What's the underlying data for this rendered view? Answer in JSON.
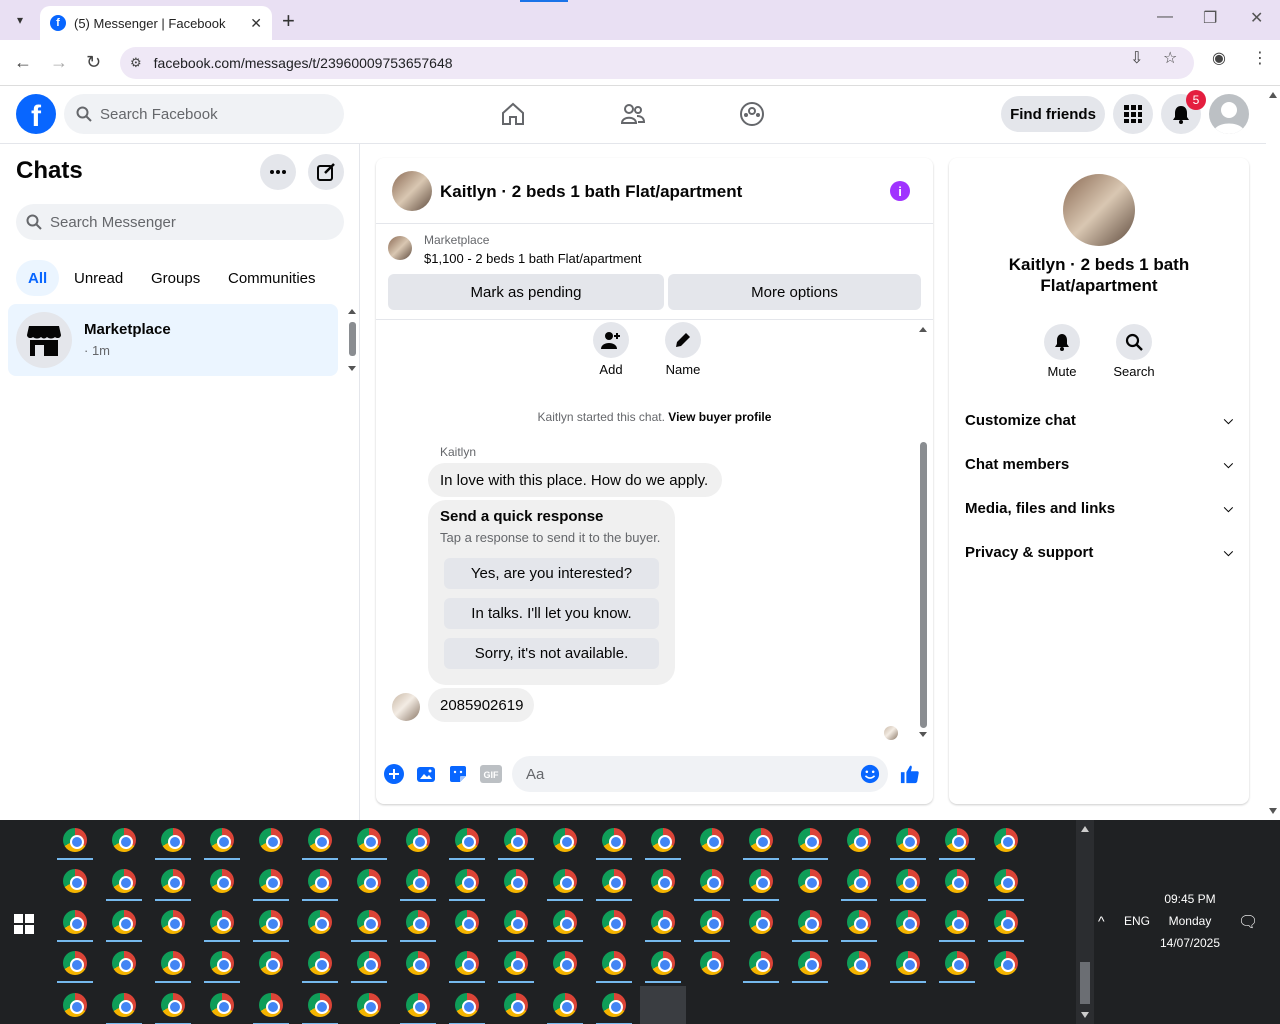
{
  "browser": {
    "tab_title": "(5) Messenger | Facebook",
    "url": "facebook.com/messages/t/23960009753657648"
  },
  "fb": {
    "search_placeholder": "Search Facebook",
    "find_friends": "Find friends",
    "notification_count": "5"
  },
  "sidebar": {
    "title": "Chats",
    "search_placeholder": "Search Messenger",
    "filters": [
      "All",
      "Unread",
      "Groups",
      "Communities"
    ],
    "chat": {
      "name": "Marketplace",
      "time": "· 1m"
    }
  },
  "conversation": {
    "title": "Kaitlyn · 2 beds 1 bath Flat/apartment",
    "marketplace_label": "Marketplace",
    "listing": "$1,100 - 2 beds 1 bath Flat/apartment",
    "mark_pending": "Mark as pending",
    "more_options": "More options",
    "actions": [
      "Add",
      "Name"
    ],
    "started_text": "Kaitlyn started this chat.",
    "buyer_profile_link": "View buyer profile",
    "sender_name": "Kaitlyn",
    "message1": "In love with this place. How do we apply.",
    "quick_title": "Send a quick response",
    "quick_sub": "Tap a response to send it to the buyer.",
    "quick_responses": [
      "Yes, are you interested?",
      "In talks. I'll let you know.",
      "Sorry, it's not available."
    ],
    "message2": "2085902619",
    "composer_placeholder": "Aa",
    "composer_gif": "GIF"
  },
  "right_panel": {
    "title": "Kaitlyn · 2 beds 1 bath Flat/apartment",
    "actions": [
      "Mute",
      "Search"
    ],
    "sections": [
      "Customize chat",
      "Chat members",
      "Media, files and links",
      "Privacy & support"
    ]
  },
  "tray": {
    "lang": "ENG",
    "time": "09:45 PM",
    "day": "Monday",
    "date": "14/07/2025"
  },
  "colors": {
    "fb_blue": "#0866ff",
    "info_purple": "#a033ff",
    "badge_red": "#e41e3f",
    "taskbar": "#1f2123"
  }
}
